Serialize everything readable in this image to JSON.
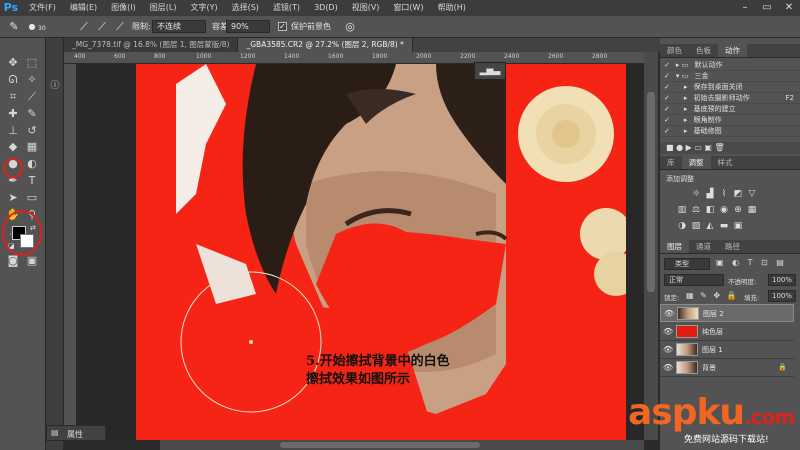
{
  "menubar": {
    "logo": "Ps",
    "items": [
      "文件(F)",
      "编辑(E)",
      "图像(I)",
      "图层(L)",
      "文字(Y)",
      "选择(S)",
      "滤镜(T)",
      "3D(D)",
      "视图(V)",
      "窗口(W)",
      "帮助(H)"
    ],
    "controls": [
      "–",
      "▭",
      "✕"
    ]
  },
  "options": {
    "brush_size": "30",
    "limit_label": "限制:",
    "limit_value": "不连续",
    "tolerance_label": "容差:",
    "tolerance_value": "90%",
    "protect_label": "保护前景色",
    "protect_checked": "✓"
  },
  "tabs": [
    {
      "label": "_MG_7378.tif @ 16.8% (图层 1, 图层蒙版/8)",
      "active": false
    },
    {
      "label": "_GBA3585.CR2 @ 27.2% (图层 2, RGB/8) *",
      "active": true
    }
  ],
  "ruler_ticks": [
    "400",
    "600",
    "800",
    "1000",
    "1200",
    "1400",
    "1600",
    "1800",
    "2000",
    "2200",
    "2400",
    "2600",
    "2800"
  ],
  "annotation": {
    "line1": "5.开始擦拭背景中的白色",
    "line2": "擦拭效果如图所示"
  },
  "properties_panel": {
    "label": "属性"
  },
  "top_panel": {
    "tabs": [
      "颜色",
      "色板",
      "动作"
    ],
    "rows": [
      {
        "label": "默认动作",
        "level": 0
      },
      {
        "label": "三金",
        "level": 0
      },
      {
        "label": "保存到桌面关闭",
        "level": 1
      },
      {
        "label": "初始去摄影师动作",
        "level": 1
      },
      {
        "label": "基底预的建立",
        "level": 1
      },
      {
        "label": "眼角制作",
        "level": 1
      },
      {
        "label": "基础修图",
        "level": 1
      }
    ],
    "shortcut": "F2"
  },
  "adjust_panel": {
    "tabs": [
      "库",
      "调整",
      "样式"
    ],
    "title": "添加调整"
  },
  "layers_panel": {
    "tabs": [
      "图层",
      "通道",
      "路径"
    ],
    "filter_label": "类型",
    "blend_mode": "正常",
    "opacity_label": "不透明度:",
    "opacity_value": "100%",
    "lock_label": "锁定:",
    "fill_label": "填充:",
    "fill_value": "100%",
    "layers": [
      {
        "name": "图层 2",
        "selected": true,
        "thumb": "photo"
      },
      {
        "name": "纯色层",
        "selected": false,
        "thumb": "red"
      },
      {
        "name": "图层 1",
        "selected": false,
        "thumb": "photo"
      },
      {
        "name": "背景",
        "selected": false,
        "thumb": "photo",
        "locked": true
      }
    ]
  },
  "watermark": {
    "brand": "aspku",
    "brand_suffix": ".com",
    "tagline": "免费网站源码下载站!"
  },
  "colors": {
    "canvas_red": "#f52414",
    "highlight_red": "#e0201a",
    "brand_orange": "#f26522",
    "brand_red": "#d9261c"
  }
}
